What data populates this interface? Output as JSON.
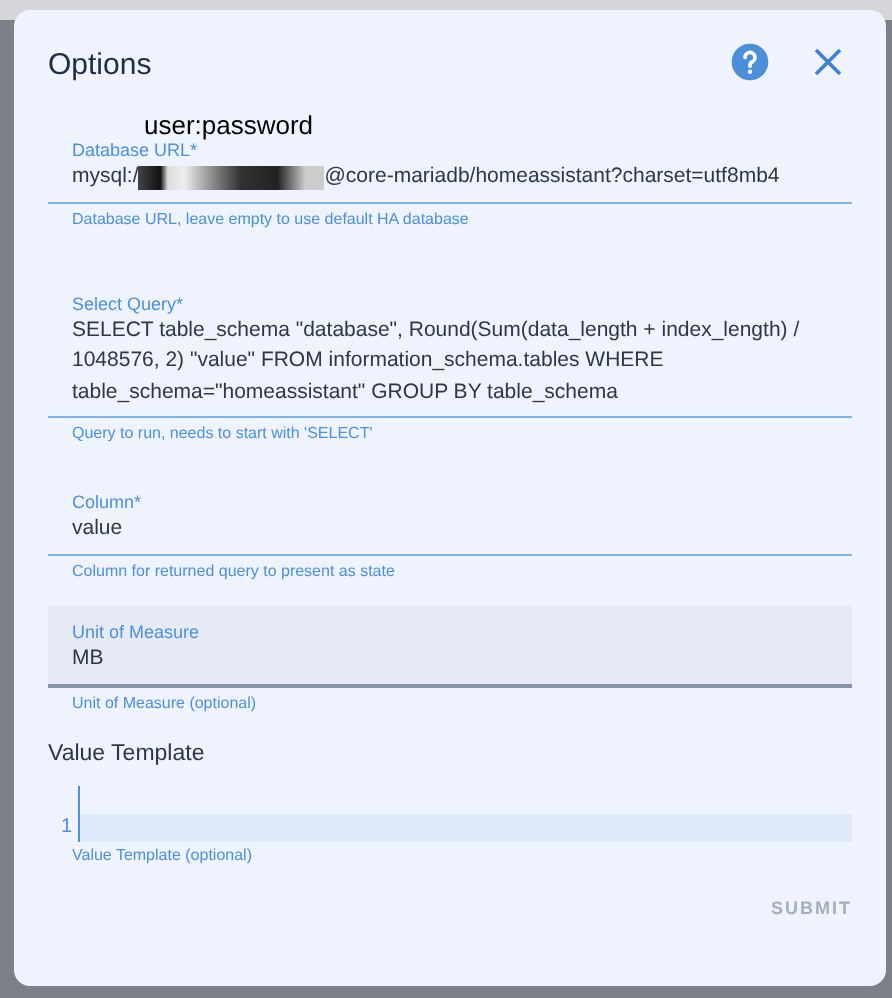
{
  "dialog": {
    "title": "Options",
    "annotation": "user:password",
    "fields": [
      {
        "kind": "text",
        "label": "Database URL*",
        "value_start": "mysql:/",
        "redacted": true,
        "value_end": "@core-mariadb/homeassistant?charset=utf8mb4",
        "helper": "Database URL, leave empty to use default HA database",
        "focused": false
      },
      {
        "kind": "text",
        "label": "Select Query*",
        "value_start": "SELECT table_schema \"database\", Round(Sum(data_length + index_length) / 1048576, 2) \"value\" FROM information_schema.tables WHERE table_schema=\"homeassistant\" GROUP BY table_schema",
        "helper": "Query to run, needs to start with 'SELECT'",
        "focused": false
      },
      {
        "kind": "text",
        "label": "Column*",
        "value_start": "value",
        "helper": "Column for returned query to present as state",
        "focused": false
      },
      {
        "kind": "text",
        "label": "Unit of Measure",
        "value_start": "MB",
        "helper": "Unit of Measure (optional)",
        "focused": true
      },
      {
        "kind": "code",
        "label": "Value Template",
        "line_number": "1",
        "helper": "Value Template (optional)"
      }
    ],
    "submit": {
      "label": "SUBMIT",
      "disabled": true
    }
  }
}
